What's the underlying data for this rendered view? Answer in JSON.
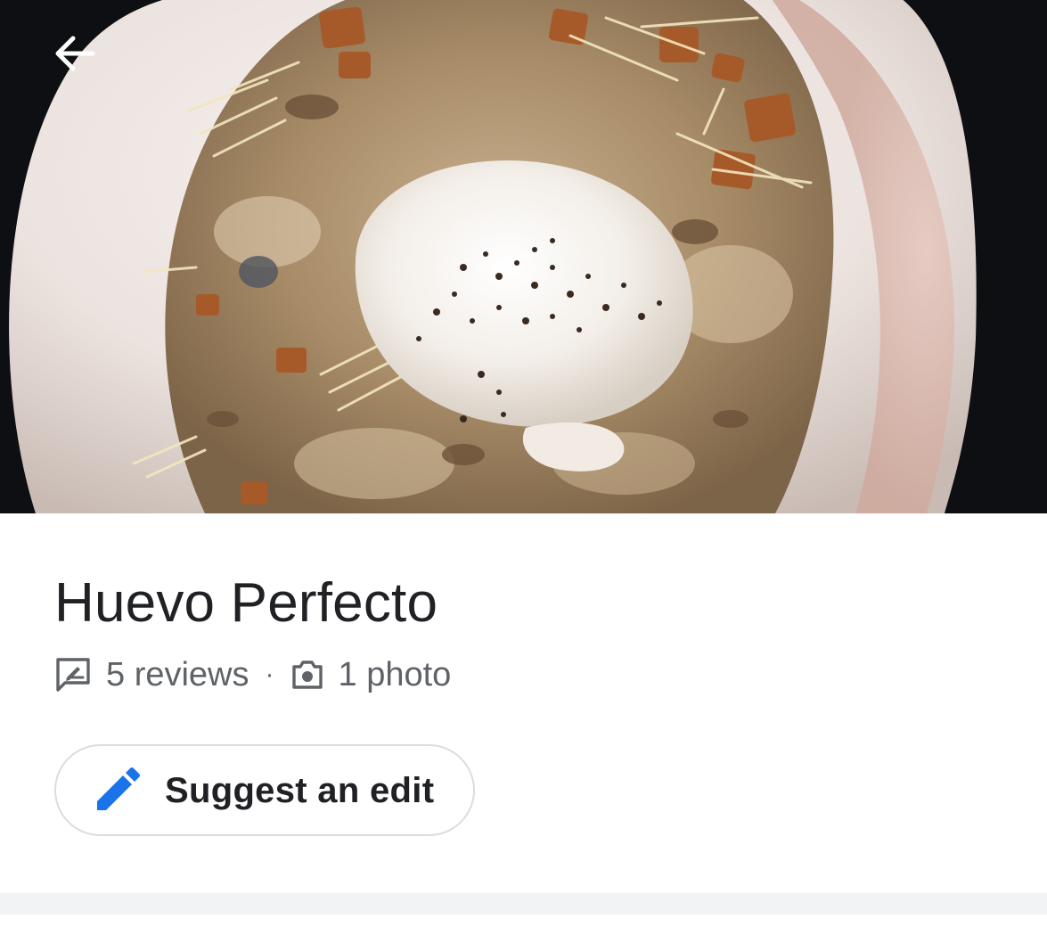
{
  "header": {
    "back_icon": "arrow-left-icon",
    "photo_subject": "dish-photo"
  },
  "place": {
    "title": "Huevo Perfecto",
    "reviews_label": "5 reviews",
    "separator": "·",
    "photos_label": "1 photo",
    "review_icon": "review-icon",
    "photo_icon": "camera-icon"
  },
  "actions": {
    "suggest_edit_label": "Suggest an edit",
    "suggest_edit_icon": "pencil-icon"
  },
  "colors": {
    "title_text": "#202124",
    "secondary_text": "#5f6368",
    "accent_blue": "#1a73e8",
    "button_border": "#dadce0",
    "divider": "#f1f3f4"
  }
}
